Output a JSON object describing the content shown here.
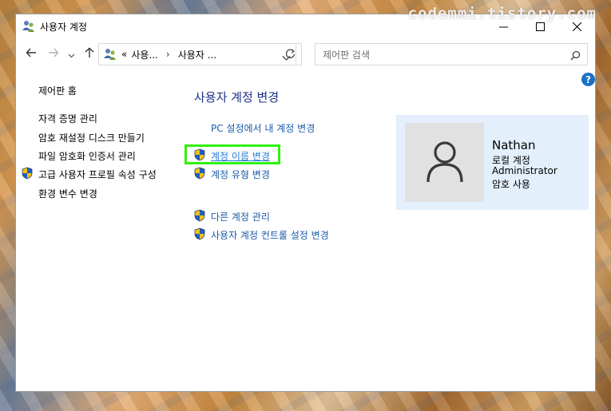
{
  "watermark": "codemmi.tistory.com",
  "window": {
    "title": "사용자 계정"
  },
  "address": {
    "overflow": "«",
    "crumb1": "사용...",
    "separator": "›",
    "crumb2": "사용자 ..."
  },
  "search": {
    "placeholder": "제어판 검색"
  },
  "help": {
    "label": "?"
  },
  "sidebar": {
    "home": "제어판 홈",
    "items": [
      "자격 증명 관리",
      "암호 재설정 디스크 만들기",
      "파일 암호화 인증서 관리",
      "고급 사용자 프로필 속성 구성",
      "환경 변수 변경"
    ]
  },
  "main": {
    "title": "사용자 계정 변경",
    "links": [
      "PC 설정에서 내 계정 변경",
      "계정 이름 변경",
      "계정 유형 변경"
    ],
    "links2": [
      "다른 계정 관리",
      "사용자 계정 컨트롤 설정 변경"
    ]
  },
  "user": {
    "name": "Nathan",
    "type": "로컬 계정",
    "role": "Administrator",
    "password": "암호 사용"
  },
  "colors": {
    "link": "#1c5ba8",
    "title": "#1e3287",
    "highlight": "#2ff20b",
    "card": "#e3effb"
  }
}
